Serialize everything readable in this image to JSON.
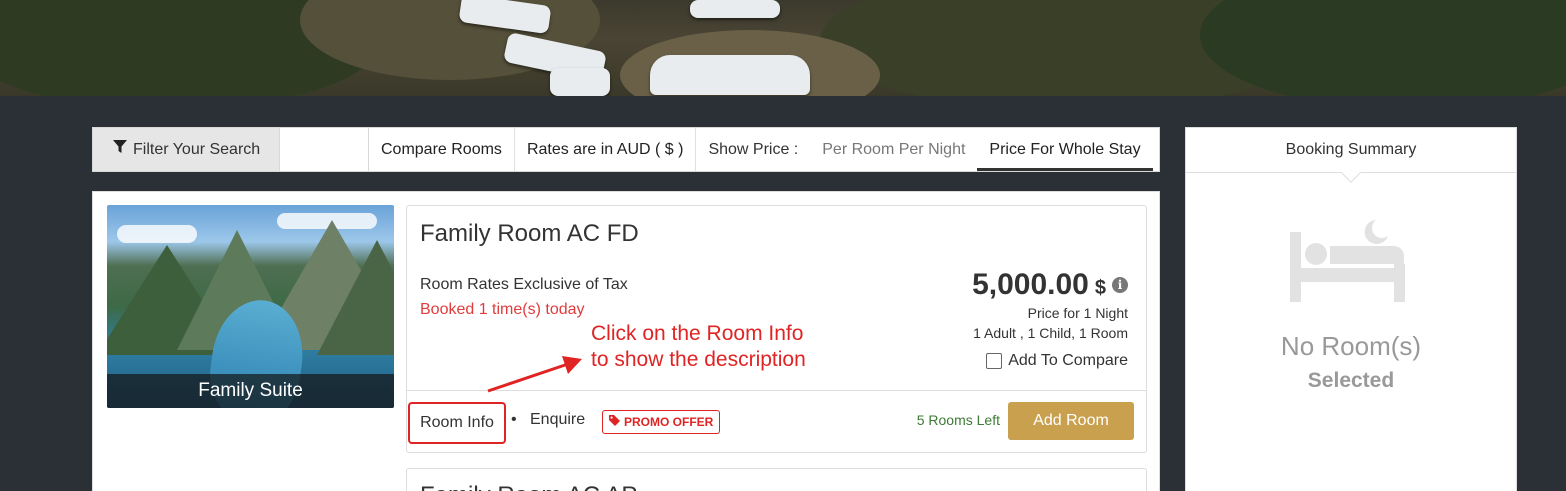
{
  "filter_bar": {
    "filter_label": "Filter Your Search",
    "compare_label": "Compare Rooms",
    "rates_label": "Rates are in AUD ( $ )",
    "show_price_label": "Show Price :",
    "per_room_label": "Per Room Per Night",
    "whole_stay_label": "Price For Whole Stay"
  },
  "room": {
    "image_caption": "Family Suite",
    "title": "Family Room AC FD",
    "rates_note": "Room Rates Exclusive of Tax",
    "booked_note": "Booked 1 time(s) today",
    "price": "5,000.00",
    "currency": "$",
    "price_period": "Price for 1 Night",
    "occupancy": "1 Adult , 1 Child, 1 Room",
    "compare_label": "Add To Compare",
    "room_info_label": "Room Info",
    "separator": "•",
    "enquire_label": "Enquire",
    "promo_label": "PROMO OFFER",
    "rooms_left": "5 Rooms Left",
    "add_room_label": "Add Room"
  },
  "annotation": {
    "line1": "Click on the Room Info",
    "line2": "to show the description"
  },
  "next_room": {
    "title": "Family Room AC AP"
  },
  "summary": {
    "title": "Booking Summary",
    "empty_line1": "No Room(s)",
    "empty_line2": "Selected"
  },
  "icons": {
    "filter": "filter-icon",
    "info": "info-icon",
    "tag": "tag-icon",
    "bed": "bed-icon"
  },
  "colors": {
    "accent": "#c8a04e",
    "alert": "#e02424",
    "success": "#3d7a35",
    "page_bg": "#2b2f36"
  }
}
